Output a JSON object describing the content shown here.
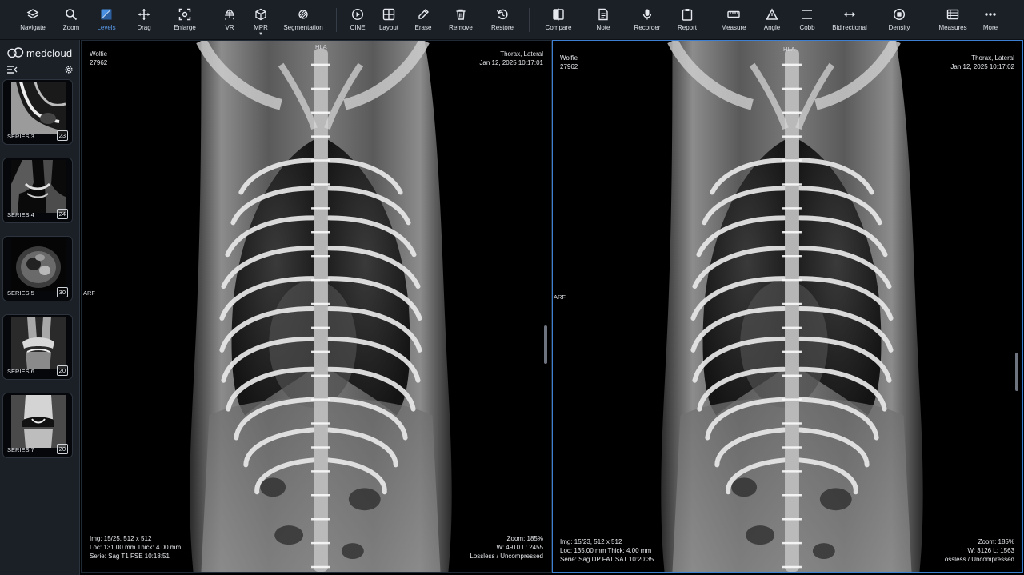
{
  "toolbar": {
    "items": [
      {
        "label": "Navigate",
        "icon": "navigate-icon"
      },
      {
        "label": "Zoom",
        "icon": "zoom-icon"
      },
      {
        "label": "Levels",
        "icon": "levels-icon",
        "active": true
      },
      {
        "label": "Drag",
        "icon": "drag-icon"
      },
      {
        "label": "Enlarge",
        "icon": "enlarge-icon"
      },
      {
        "label": "VR",
        "icon": "vr-icon"
      },
      {
        "label": "MPR",
        "icon": "mpr-icon",
        "dropdown": true
      },
      {
        "label": "Segmentation",
        "icon": "segmentation-icon"
      },
      {
        "label": "CINE",
        "icon": "cine-icon"
      },
      {
        "label": "Layout",
        "icon": "layout-icon"
      },
      {
        "label": "Erase",
        "icon": "erase-icon"
      },
      {
        "label": "Remove",
        "icon": "remove-icon"
      },
      {
        "label": "Restore",
        "icon": "restore-icon"
      },
      {
        "label": "Compare",
        "icon": "compare-icon"
      },
      {
        "label": "Note",
        "icon": "note-icon"
      },
      {
        "label": "Recorder",
        "icon": "recorder-icon"
      },
      {
        "label": "Report",
        "icon": "report-icon"
      },
      {
        "label": "Measure",
        "icon": "measure-icon"
      },
      {
        "label": "Angle",
        "icon": "angle-icon"
      },
      {
        "label": "Cobb",
        "icon": "cobb-icon"
      },
      {
        "label": "Bidirectional",
        "icon": "bidirectional-icon"
      },
      {
        "label": "Density",
        "icon": "density-icon"
      },
      {
        "label": "Measures",
        "icon": "measures-icon"
      },
      {
        "label": "More",
        "icon": "more-icon"
      }
    ],
    "accent_color": "#4a90e2"
  },
  "sidebar": {
    "brand": "medcloud",
    "series": [
      {
        "label": "SERIES 3",
        "count": "23"
      },
      {
        "label": "SERIES 4",
        "count": "24"
      },
      {
        "label": "SERIES 5",
        "count": "30"
      },
      {
        "label": "SERIES 6",
        "count": "20"
      },
      {
        "label": "SERIES 7",
        "count": "20"
      }
    ]
  },
  "viewports": [
    {
      "patient_name": "Wolfie",
      "patient_id": "27962",
      "study": "Thorax, Lateral",
      "datetime": "Jan 12, 2025 10:17:01",
      "orientation_top": "HLA",
      "orientation_left": "ARF",
      "img": "Img: 15/25, 512 x 512",
      "loc": "Loc: 131.00 mm Thick: 4.00 mm",
      "serie": "Serie: Sag T1 FSE 10:18:51",
      "zoom": "Zoom: 185%",
      "wl": "W: 4910 L: 2455",
      "compression": "Lossless / Uncompressed",
      "selected": false
    },
    {
      "patient_name": "Wolfie",
      "patient_id": "27962",
      "study": "Thorax, Lateral",
      "datetime": "Jan 12, 2025 10:17:02",
      "orientation_top": "HLA",
      "orientation_left": "ARF",
      "img": "Img: 15/23, 512 x 512",
      "loc": "Loc: 135.00 mm Thick: 4.00 mm",
      "serie": "Serie: Sag DP FAT SAT 10:20:35",
      "zoom": "Zoom: 185%",
      "wl": "W: 3126 L: 1563",
      "compression": "Lossless / Uncompressed",
      "selected": true
    }
  ]
}
